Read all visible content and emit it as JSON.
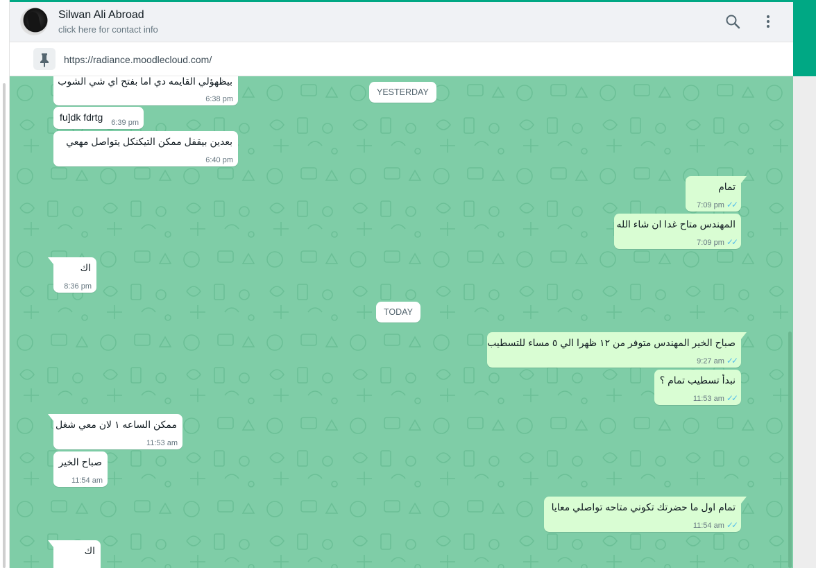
{
  "header": {
    "contact_name": "Silwan Ali Abroad",
    "contact_subtitle": "click here for contact info",
    "icons": [
      "search-icon",
      "menu-icon"
    ]
  },
  "pinned": {
    "url": "https://radiance.moodlecloud.com/",
    "icon": "pin-icon"
  },
  "colors": {
    "accent": "#00a884",
    "chat_background": "#7fcda7",
    "incoming_bubble": "#ffffff",
    "outgoing_bubble": "#d9fdd3",
    "read_ticks": "#53bdeb"
  },
  "chat": {
    "dates": [
      "YESTERDAY",
      "TODAY"
    ],
    "messages": [
      {
        "direction": "in",
        "text": "بيظهؤلي القايمه دي اما بفتح اي شي الشوب",
        "time": "6:38 pm"
      },
      {
        "direction": "in",
        "text": "fu]dk fdrtg",
        "time": "6:39 pm"
      },
      {
        "direction": "in",
        "text": "بعدين بيقفل ممكن التيكنكل يتواصل مهعي",
        "time": "6:40 pm"
      },
      {
        "direction": "out",
        "text": "تمام",
        "time": "7:09 pm"
      },
      {
        "direction": "out",
        "text": "المهندس متاح غدا ان شاء الله",
        "time": "7:09 pm"
      },
      {
        "direction": "in",
        "text": "اك",
        "time": "8:36 pm"
      },
      {
        "direction": "out",
        "text": "صباح الخير المهندس متوفر من ١٢ ظهرا الي ٥ مساء للتسطيب",
        "time": "9:27 am"
      },
      {
        "direction": "out",
        "text": "نبدأ تسطيب تمام ؟",
        "time": "11:53 am"
      },
      {
        "direction": "in",
        "text": "ممكن الساعه ١ لان معي شغل",
        "time": "11:53 am"
      },
      {
        "direction": "in",
        "text": "صباح الخير",
        "time": "11:54 am"
      },
      {
        "direction": "out",
        "text": "تمام اول ما حضرتك تكوني متاحه تواصلي معايا",
        "time": "11:54 am"
      },
      {
        "direction": "in",
        "text": "اك",
        "time": ""
      }
    ]
  }
}
